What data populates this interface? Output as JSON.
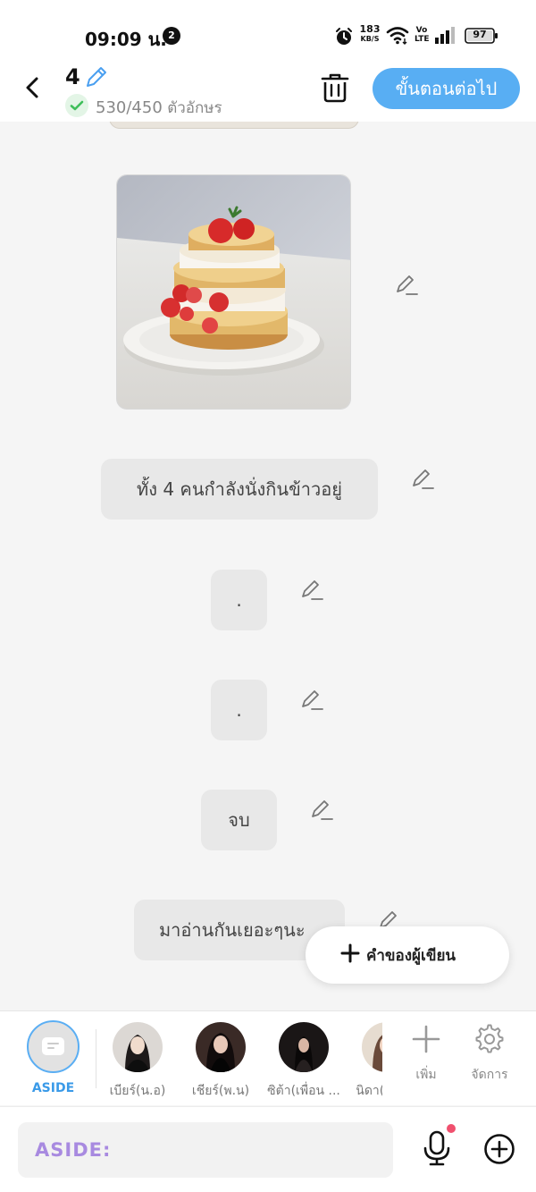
{
  "status_bar": {
    "time": "09:09 น.",
    "notification_count": "2",
    "net_speed_value": "183",
    "net_speed_unit": "KB/S",
    "volte_top": "Vo",
    "volte_bottom": "LTE",
    "battery": "97"
  },
  "header": {
    "chapter_number": "4",
    "char_count": "530/450",
    "char_count_unit": "ตัวอักษร",
    "next_button_label": "ขั้นตอนต่อไป"
  },
  "messages": [
    {
      "type": "image",
      "description_icon": "pancake-stack-image"
    },
    {
      "type": "text",
      "text": "ทั้ง 4 คนกำลังนั่งกินข้าวอยู่"
    },
    {
      "type": "text",
      "text": "."
    },
    {
      "type": "text",
      "text": "."
    },
    {
      "type": "text",
      "text": "จบ"
    },
    {
      "type": "text",
      "text": "มาอ่านกันเยอะๆนะ"
    }
  ],
  "writer_button_label": "คำของผู้เขียน",
  "characters": {
    "aside_label": "ASIDE",
    "items": [
      {
        "name": "เบียร์(น.อ)"
      },
      {
        "name": "เชียร์(พ.น)"
      },
      {
        "name": "ซิต้า(เพื่อน ..."
      },
      {
        "name": "นิดา(เพื่อน)"
      }
    ],
    "add_label": "เพิ่ม",
    "manage_label": "จัดการ"
  },
  "input": {
    "placeholder": "ASIDE:"
  },
  "colors": {
    "accent": "#58aef3",
    "bubble": "#e8e8e8",
    "aside_placeholder": "#a88ae0",
    "mic_dot": "#f0506e"
  }
}
